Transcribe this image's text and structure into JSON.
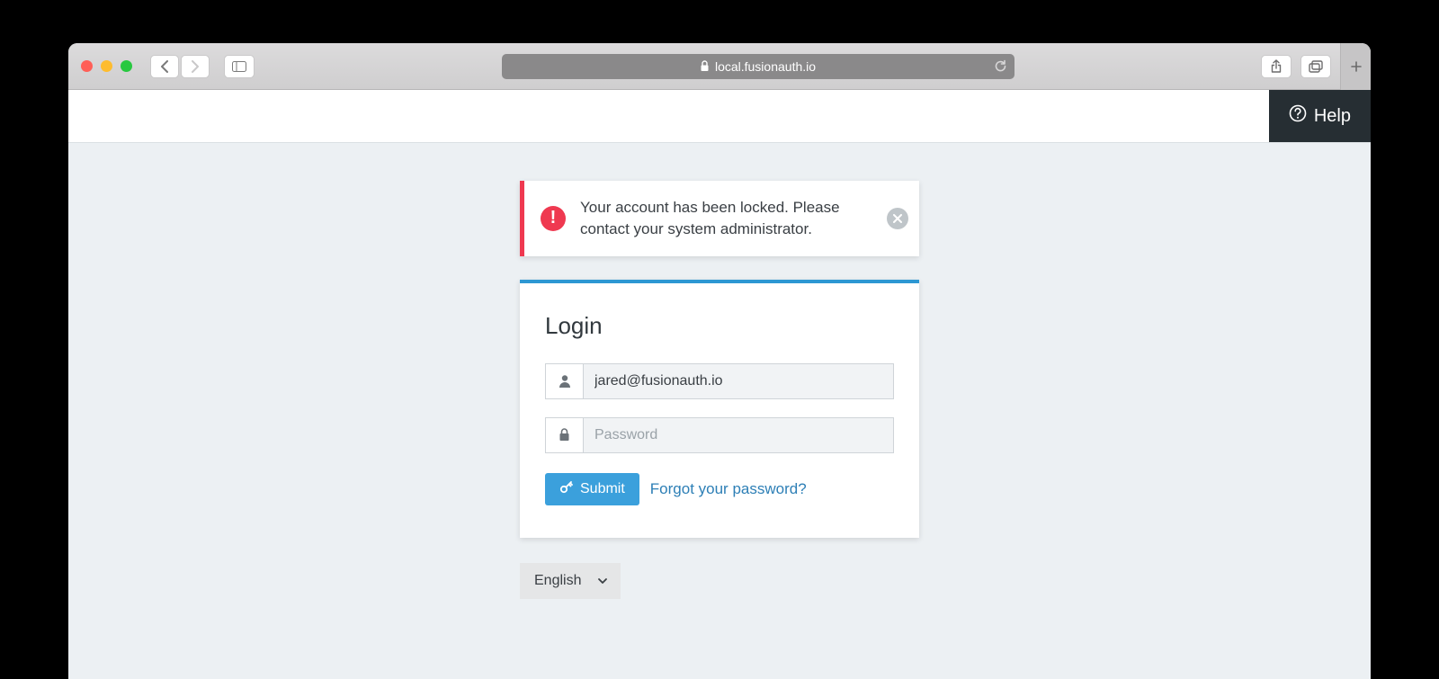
{
  "browser": {
    "address": "local.fusionauth.io"
  },
  "header": {
    "help_label": "Help"
  },
  "alert": {
    "message": "Your account has been locked. Please contact your system administrator."
  },
  "login": {
    "title": "Login",
    "email_value": "jared@fusionauth.io",
    "password_placeholder": "Password",
    "submit_label": "Submit",
    "forgot_label": "Forgot your password?"
  },
  "language": {
    "selected": "English"
  }
}
